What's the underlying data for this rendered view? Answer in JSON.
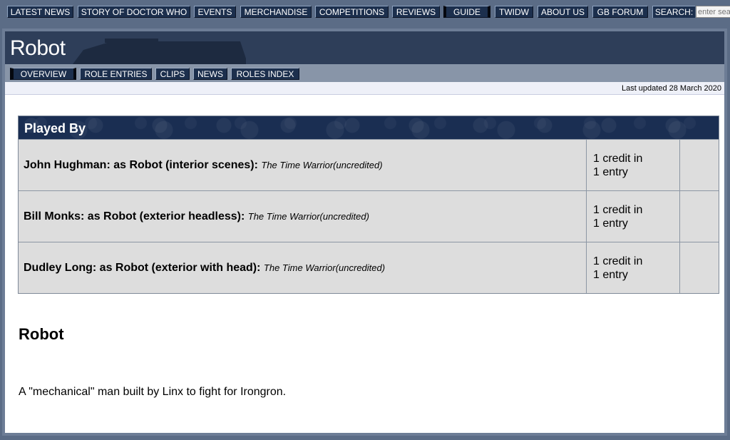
{
  "topnav": {
    "items": [
      {
        "label": "LATEST NEWS"
      },
      {
        "label": "STORY OF DOCTOR WHO"
      },
      {
        "label": "EVENTS"
      },
      {
        "label": "MERCHANDISE"
      },
      {
        "label": "COMPETITIONS"
      },
      {
        "label": "REVIEWS"
      },
      {
        "label": "GUIDE"
      },
      {
        "label": "TWIDW"
      },
      {
        "label": "ABOUT US"
      },
      {
        "label": "GB FORUM"
      }
    ],
    "search_label": "SEARCH:",
    "search_placeholder": "enter search"
  },
  "page": {
    "title": "Robot",
    "tabs": [
      {
        "label": "OVERVIEW"
      },
      {
        "label": "ROLE ENTRIES"
      },
      {
        "label": "CLIPS"
      },
      {
        "label": "NEWS"
      },
      {
        "label": "ROLES INDEX"
      }
    ],
    "last_updated": "Last updated 28 March 2020"
  },
  "played_by": {
    "heading": "Played By",
    "rows": [
      {
        "actor": "John Hughman",
        "role": ": as Robot (interior scenes):",
        "story": "The Time Warrior",
        "note": "(uncredited)",
        "credits": "1 credit in",
        "entries": "1 entry"
      },
      {
        "actor": "Bill Monks",
        "role": ": as Robot (exterior headless):",
        "story": "The Time Warrior",
        "note": "(uncredited)",
        "credits": "1 credit in",
        "entries": "1 entry"
      },
      {
        "actor": "Dudley Long",
        "role": ": as Robot (exterior with head):",
        "story": "The Time Warrior",
        "note": "(uncredited)",
        "credits": "1 credit in",
        "entries": "1 entry"
      }
    ]
  },
  "description": {
    "heading": "Robot",
    "text": "A \"mechanical\" man built by Linx to fight for Irongron."
  },
  "colors": {
    "nav_button": "#1c2f4d",
    "title_band": "#2e3e59",
    "table_header": "#1a2e52",
    "row_bg": "#dddddd"
  }
}
